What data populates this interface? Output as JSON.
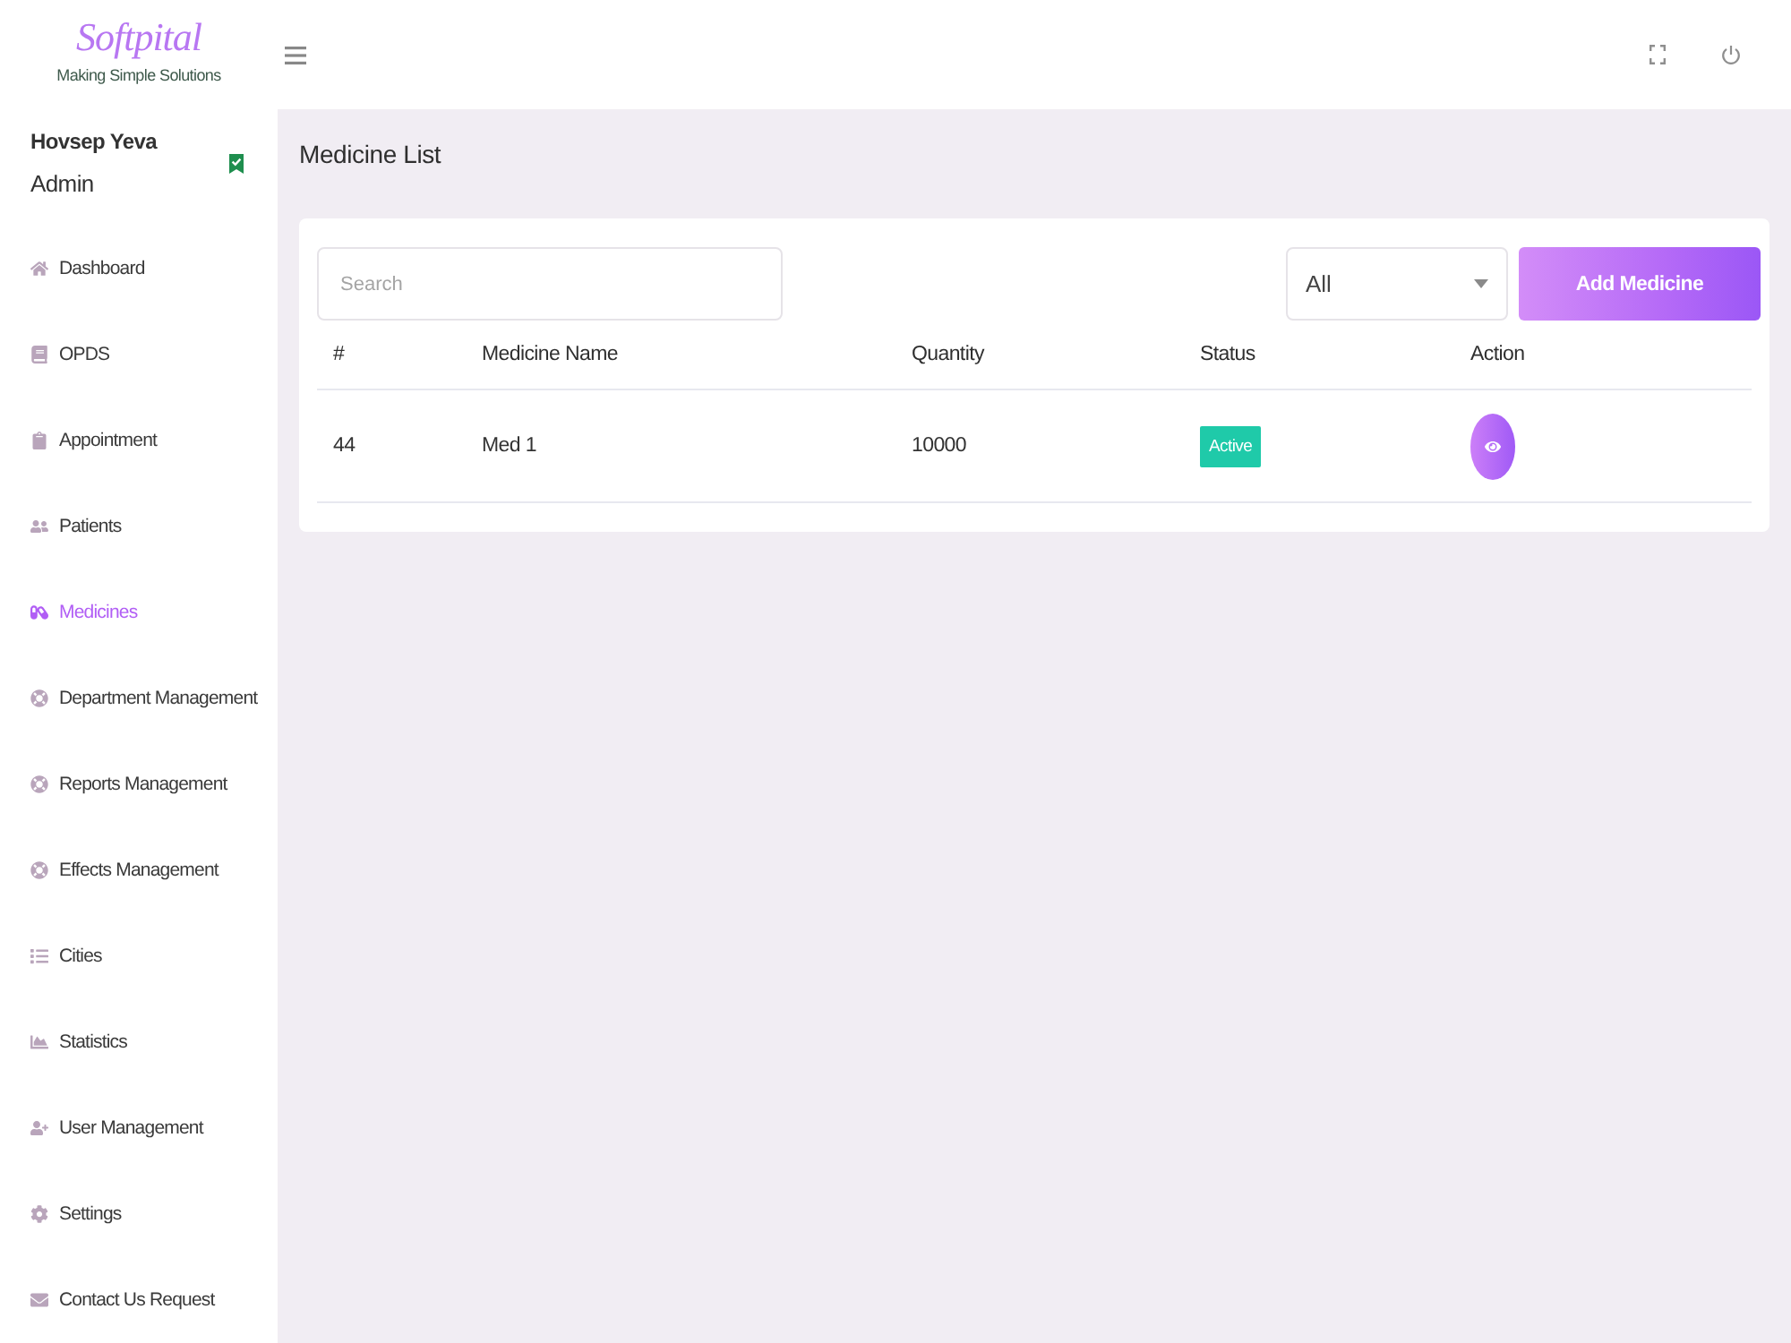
{
  "brand": {
    "name": "Softpital",
    "tagline": "Making Simple Solutions"
  },
  "user": {
    "name": "Hovsep Yeva",
    "role": "Admin"
  },
  "sidebar": {
    "items": [
      {
        "label": "Dashboard",
        "selected": false
      },
      {
        "label": "OPDS",
        "selected": false
      },
      {
        "label": "Appointment",
        "selected": false
      },
      {
        "label": "Patients",
        "selected": false
      },
      {
        "label": "Medicines",
        "selected": true
      },
      {
        "label": "Department Management",
        "selected": false
      },
      {
        "label": "Reports Management",
        "selected": false
      },
      {
        "label": "Effects Management",
        "selected": false
      },
      {
        "label": "Cities",
        "selected": false
      },
      {
        "label": "Statistics",
        "selected": false
      },
      {
        "label": "User Management",
        "selected": false
      },
      {
        "label": "Settings",
        "selected": false
      },
      {
        "label": "Contact Us Request",
        "selected": false
      }
    ]
  },
  "page": {
    "title": "Medicine List"
  },
  "toolbar": {
    "search": {
      "placeholder": "Search"
    },
    "filter": {
      "value": "All"
    },
    "add_button": "Add Medicine"
  },
  "table": {
    "columns": [
      "#",
      "Medicine Name",
      "Quantity",
      "Status",
      "Action"
    ],
    "rows": [
      {
        "cells": [
          "44",
          "Med 1",
          "10000"
        ],
        "status": {
          "label": "Active",
          "active": true
        }
      }
    ]
  }
}
